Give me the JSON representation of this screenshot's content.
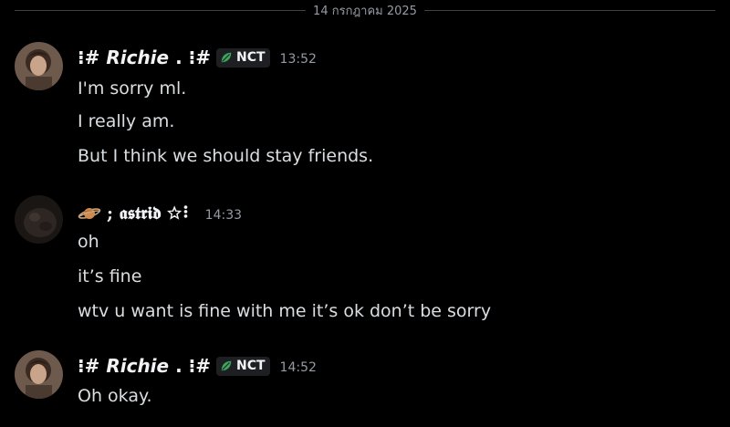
{
  "divider": {
    "date": "14 กรกฎาคม 2025"
  },
  "messages": [
    {
      "author": {
        "prefix": "⁝#",
        "name": "Richie",
        "suffix": ". ⁝#",
        "tag": "NCT"
      },
      "time": "13:52",
      "lines": [
        "I'm sorry ml.",
        "I really am.",
        "But I think we should stay friends."
      ]
    },
    {
      "author": {
        "name": "; 𝖆𝖘𝖙𝖗𝖎𝖉 ☆⠇"
      },
      "time": "14:33",
      "lines": [
        "oh",
        "it’s fine",
        "wtv u want is fine with me it’s ok don’t be sorry"
      ]
    },
    {
      "author": {
        "prefix": "⁝#",
        "name": "Richie",
        "suffix": ". ⁝#",
        "tag": "NCT"
      },
      "time": "14:52",
      "lines": [
        "Oh okay."
      ]
    }
  ],
  "colors": {
    "background": "#000000",
    "text": "#dbdee1",
    "muted": "#949ba4",
    "tag_bg": "#1e1f22",
    "leaf": "#3ba55d"
  }
}
